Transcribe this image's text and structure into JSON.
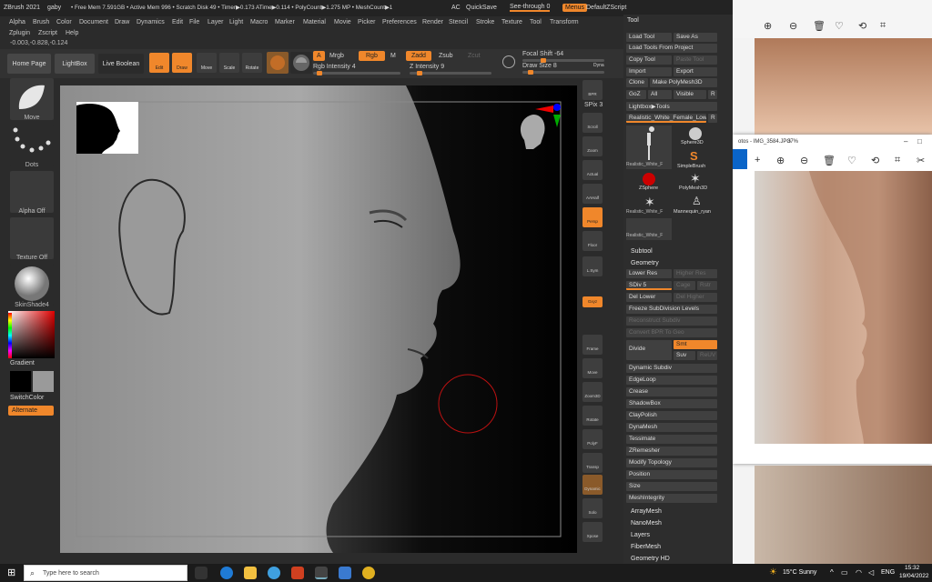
{
  "titlebar": {
    "app": "ZBrush 2021",
    "user": "gaby",
    "stats": "• Free Mem 7.591GB • Active Mem 996 • Scratch Disk 49 • Timer▶0.173 ATime▶0.114 • PolyCount▶1.275 MP • MeshCount▶1",
    "ac": "AC",
    "quicksave": "QuickSave",
    "see_through": "See-through  0",
    "menus": "Menus",
    "script": "DefaultZScript"
  },
  "menu_row1": [
    "Alpha",
    "Brush",
    "Color",
    "Document",
    "Draw",
    "Dynamics",
    "Edit",
    "File",
    "Layer",
    "Light",
    "Macro",
    "Marker",
    "Material",
    "Movie",
    "Picker",
    "Preferences",
    "Render",
    "Stencil",
    "Stroke",
    "Texture",
    "Tool",
    "Transform"
  ],
  "menu_row2": [
    "Zplugin",
    "Zscript",
    "Help"
  ],
  "coords": "-0.003,-0.828,-0.124",
  "shelf": {
    "home": "Home Page",
    "lightbox": "LightBox",
    "live_boolean": "Live Boolean",
    "edit": "Edit",
    "draw": "Draw",
    "move": "Move",
    "scale": "Scale",
    "rotate": "Rotate",
    "a": "A",
    "mrgb": "Mrgb",
    "rgb": "Rgb",
    "m": "M",
    "zadd": "Zadd",
    "zsub": "Zsub",
    "zcut": "Zcut",
    "rgb_intensity": "Rgb Intensity 4",
    "z_intensity": "Z Intensity 9",
    "focal_shift": "Focal Shift -64",
    "draw_size": "Draw Size 8",
    "dyna": "Dyna",
    "rgb_intensity_value": 4,
    "z_intensity_value": 9
  },
  "left": {
    "move": "Move",
    "dots": "Dots",
    "alpha_off": "Alpha Off",
    "texture_off": "Texture Off",
    "material": "SkinShade4",
    "gradient": "Gradient",
    "switch_color": "SwitchColor",
    "alternate": "Alternate"
  },
  "dock": {
    "bpr": "BPR",
    "spix": "SPix 3",
    "scroll": "Scroll",
    "zoom": "Zoom",
    "actual": "Actual",
    "aahalf": "AAHalf",
    "persp": "Persp",
    "floor": "Floor",
    "lsym": "L.Sym",
    "gxyz": "Gxyz",
    "frame": "Frame",
    "move": "Move",
    "zoom3d": "Zoom3D",
    "rotate": "Rotate",
    "linefill": "Line Fill",
    "polyf": "PolyF",
    "transp": "Transp",
    "dynamic": "Dynamic",
    "solo": "Solo",
    "xpose": "Xpose"
  },
  "tool": {
    "header": "Tool",
    "load_tool": "Load Tool",
    "save_as": "Save As",
    "load_project": "Load Tools From Project",
    "copy_tool": "Copy Tool",
    "paste_tool": "Paste Tool",
    "import": "Import",
    "export": "Export",
    "clone": "Clone",
    "make_polymesh": "Make PolyMesh3D",
    "goz": "GoZ",
    "all": "All",
    "visible": "Visible",
    "r": "R",
    "lightbox_tools": "Lightbox▶Tools",
    "current_tool": "Realistic_White_Female_Low",
    "thumbs": [
      "Realistic_White_F",
      "Sphere3D",
      "SimpleBrush",
      "ZSphere",
      "PolyMesh3D",
      "Realistic_White_F",
      "Mannequin_ryan",
      "Realistic_White_F"
    ],
    "subtool": "Subtool",
    "geometry": "Geometry",
    "lower_res": "Lower Res",
    "higher_res": "Higher Res",
    "sdiv": "SDiv 5",
    "cage": "Cage",
    "rstr": "Rstr",
    "del_lower": "Del Lower",
    "del_higher": "Del Higher",
    "freeze": "Freeze SubDivision Levels",
    "reconstruct": "Reconstruct Subdiv",
    "convert_bpr": "Convert BPR To Geo",
    "divide": "Divide",
    "smt": "Smt",
    "suv": "Suv",
    "reuv": "ReUV",
    "items": [
      "Dynamic Subdiv",
      "EdgeLoop",
      "Crease",
      "ShadowBox",
      "ClayPolish",
      "DynaMesh",
      "Tessimate",
      "ZRemesher",
      "Modify Topology",
      "Position",
      "Size",
      "MeshIntegrity"
    ],
    "items2": [
      "ArrayMesh",
      "NanoMesh",
      "Layers",
      "FiberMesh",
      "Geometry HD"
    ]
  },
  "photos": {
    "title": "otos - IMG_3584.JPG",
    "zoom": "37%"
  },
  "taskbar": {
    "search": "Type here to search",
    "weather": "15°C  Sunny",
    "lang": "ENG",
    "time": "15:32",
    "date": "19/04/2022"
  }
}
